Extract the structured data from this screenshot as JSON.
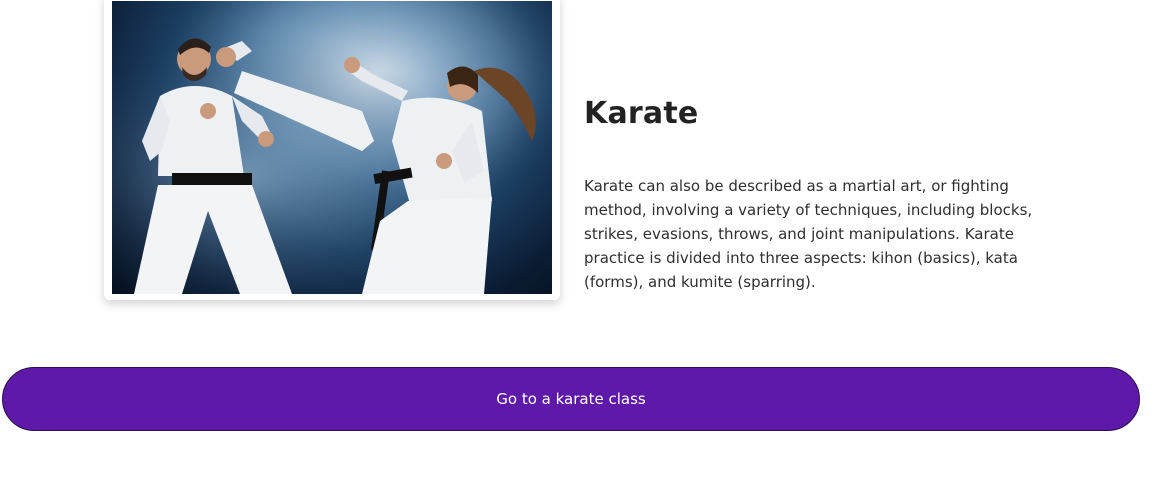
{
  "feature": {
    "image_alt": "Two karate practitioners in white gi with black belts sparring in front of a smoky blue background",
    "title": "Karate",
    "description": "Karate can also be described as a martial art, or fighting method, involving a variety of techniques, including blocks, strikes, evasions, throws, and joint manipulations. Karate practice is divided into three aspects: kihon (basics), kata (forms), and kumite (sparring)."
  },
  "cta": {
    "label": "Go to a karate class",
    "color": "#5f19a8"
  }
}
